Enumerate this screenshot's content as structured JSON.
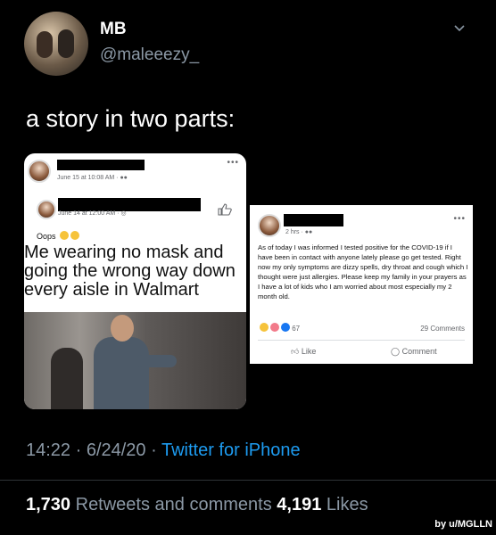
{
  "tweet": {
    "name": "MB",
    "handle": "@maleeezy_",
    "text": "a story in two parts:",
    "timestamp": "14:22 · 6/24/20 · ",
    "source": "Twitter for iPhone",
    "retweets_count": "1,730",
    "retweets_label": " Retweets and comments ",
    "likes_count": "4,191",
    "likes_label": " Likes"
  },
  "post1": {
    "outer_meta": "June 15 at 10:08 AM · ",
    "inner_meta": "June 14 at 12:00 AM · ",
    "comment": "Oops",
    "meme_text": "Me wearing no mask and going the wrong way down every aisle in Walmart"
  },
  "post2": {
    "meta": "2 hrs · ",
    "text": "As of today I was informed I tested positive for the COVID-19 if I have been in contact with anyone lately please go get tested. Right now my only symptoms are dizzy spells, dry throat and cough which I thought were just allergies. Please keep my family in your prayers as I have a lot of kids who I am worried about most especially my 2 month old.",
    "reactions_count": "67",
    "comments": "29 Comments",
    "like_label": "Like",
    "comment_label": "Comment"
  },
  "credit": "by u/MGLLN"
}
